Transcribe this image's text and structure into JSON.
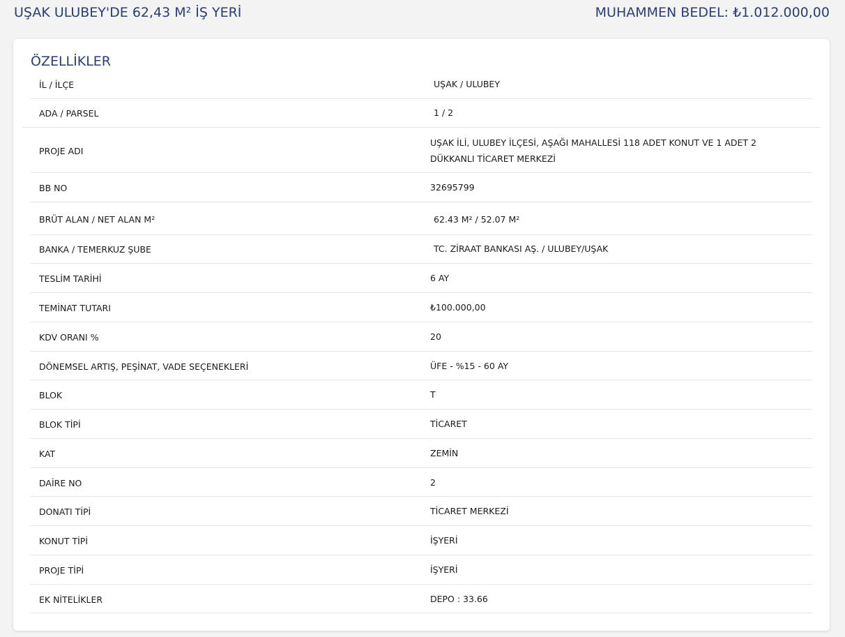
{
  "header": {
    "title": "UŞAK ULUBEY'DE 62,43 M² İŞ YERİ",
    "price": "MUHAMMEN BEDEL: ₺1.012.000,00"
  },
  "section": {
    "title": "ÖZELLİKLER"
  },
  "rows": [
    {
      "label": "İL / İLÇE",
      "value": "UŞAK / ULUBEY"
    },
    {
      "label": "ADA / PARSEL",
      "value": " 1 / 2"
    },
    {
      "label": "PROJE ADI",
      "value": "UŞAK İLİ, ULUBEY İLÇESİ, AŞAĞI MAHALLESİ 118 ADET KONUT VE 1 ADET 2 DÜKKANLI TİCARET MERKEZİ"
    },
    {
      "label": "BB NO",
      "value": "32695799"
    },
    {
      "label": "BRÜT ALAN / NET ALAN M²",
      "value": " 62.43 M² / 52.07 M²"
    },
    {
      "label": "BANKA / TEMERKUZ ŞUBE",
      "value": " TC. ZİRAAT BANKASI AŞ. / ULUBEY/UŞAK"
    },
    {
      "label": "TESLİM TARİHİ",
      "value": "6 AY"
    },
    {
      "label": "TEMİNAT TUTARI",
      "value": "₺100.000,00"
    },
    {
      "label": "KDV ORANI %",
      "value": "20"
    },
    {
      "label": "DÖNEMSEL ARTIŞ, PEŞİNAT, VADE SEÇENEKLERİ",
      "value": "ÜFE - %15 - 60 AY"
    },
    {
      "label": "BLOK",
      "value": "T"
    },
    {
      "label": "BLOK TİPİ",
      "value": "TİCARET"
    },
    {
      "label": "KAT",
      "value": "ZEMİN"
    },
    {
      "label": "DAİRE NO",
      "value": "2"
    },
    {
      "label": "DONATI TİPİ",
      "value": "TİCARET MERKEZİ"
    },
    {
      "label": "KONUT TİPİ",
      "value": "İŞYERİ"
    },
    {
      "label": "PROJE TİPİ",
      "value": "İŞYERİ"
    },
    {
      "label": "EK NİTELİKLER",
      "value": "DEPO : 33.66"
    }
  ]
}
